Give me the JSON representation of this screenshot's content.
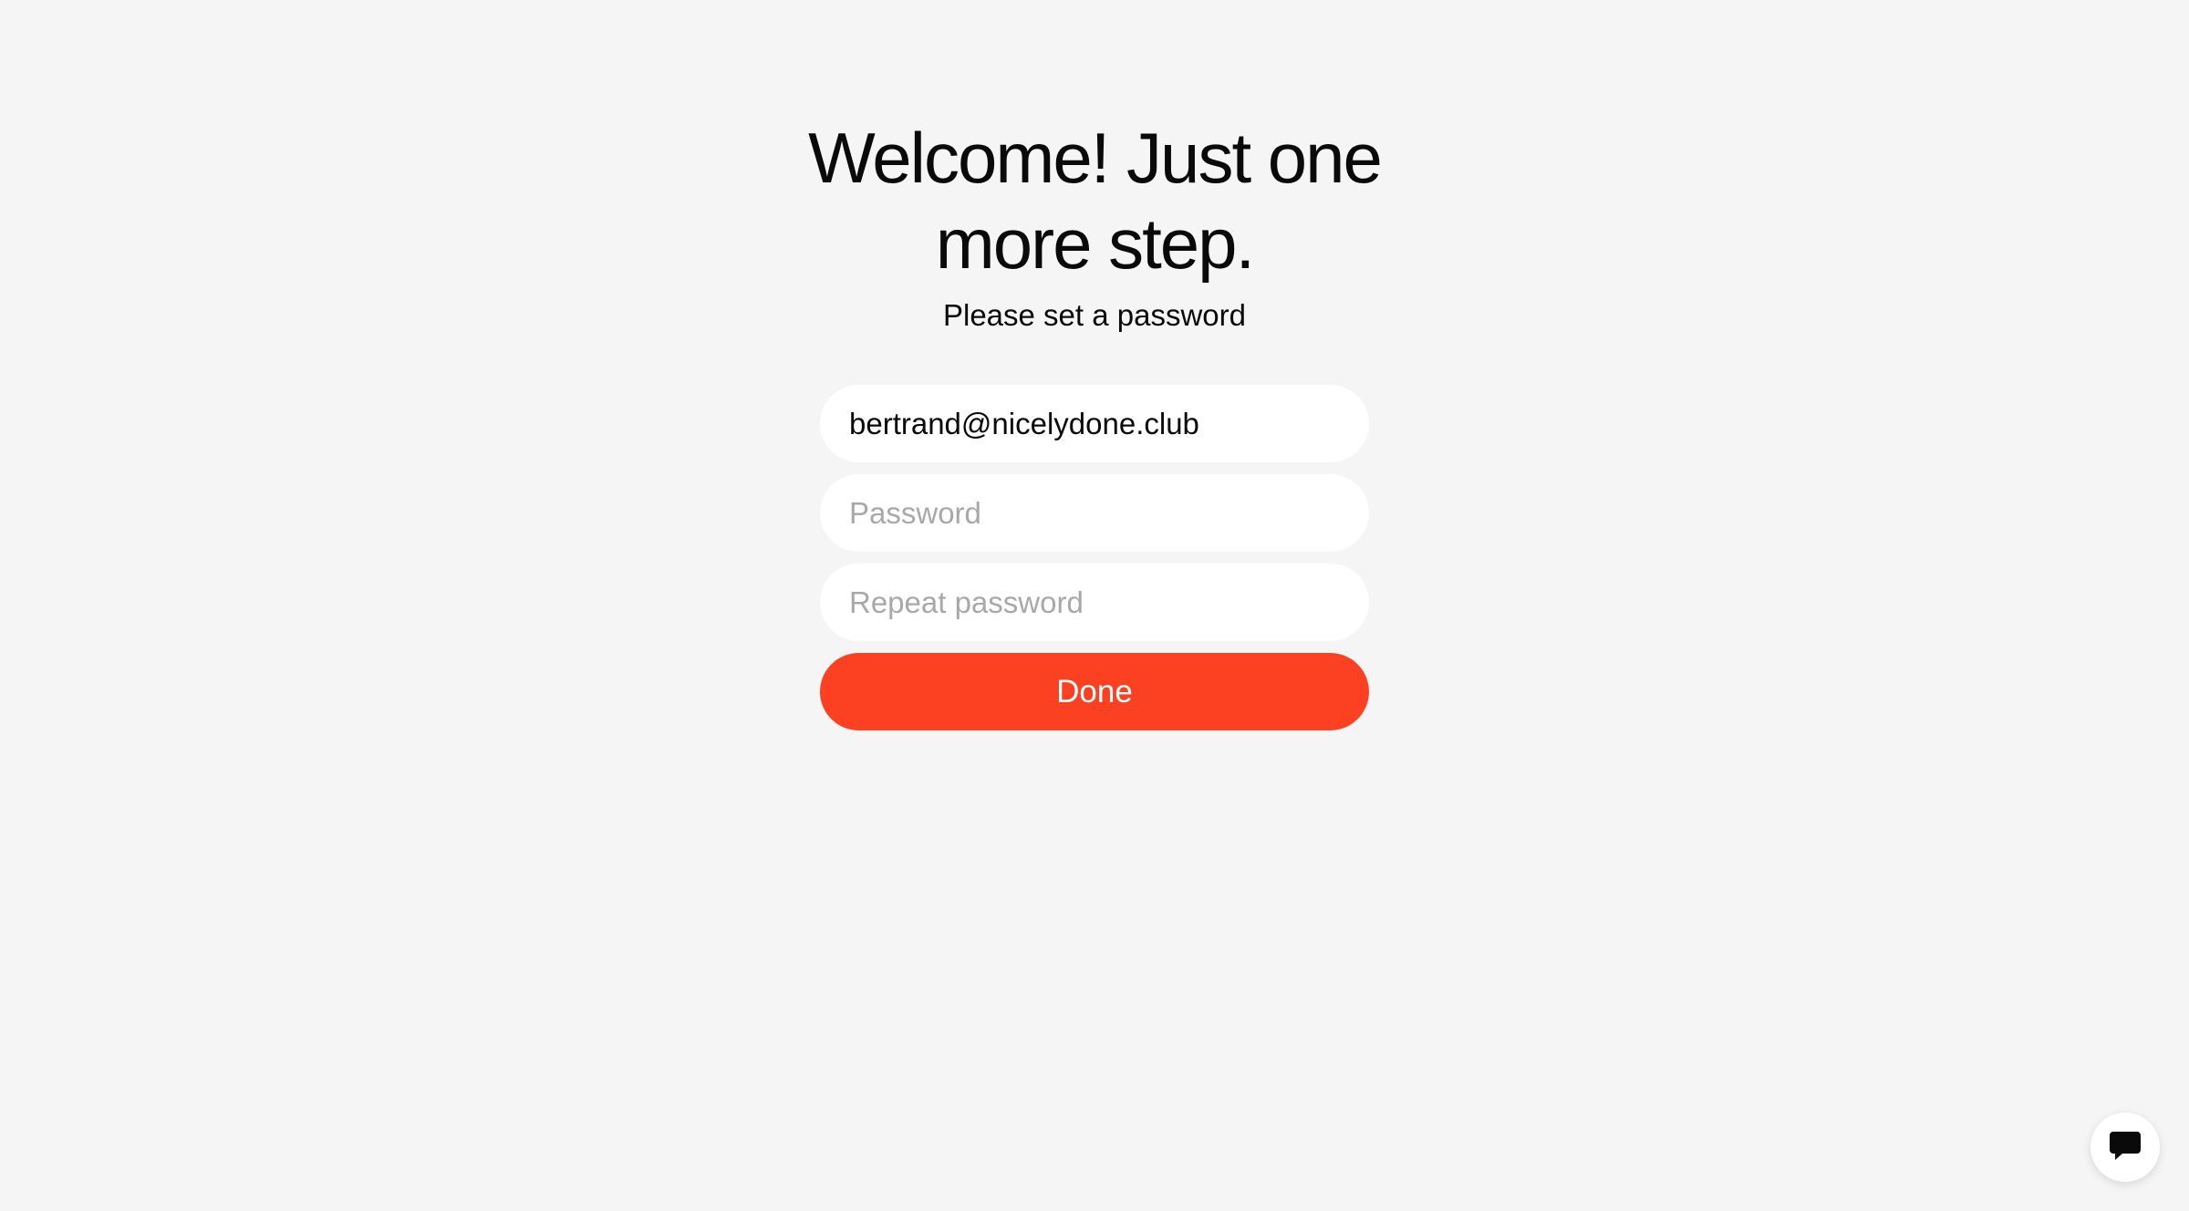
{
  "header": {
    "title": "Welcome! Just one more step.",
    "subtitle": "Please set a password"
  },
  "form": {
    "email_value": "bertrand@nicelydone.club",
    "password_placeholder": "Password",
    "repeat_password_placeholder": "Repeat password",
    "submit_label": "Done"
  },
  "chat": {
    "icon": "chat-bubble-icon"
  },
  "colors": {
    "background": "#f5f5f5",
    "accent": "#fc4122",
    "field_background": "#ffffff",
    "placeholder": "#a8a8a8"
  }
}
